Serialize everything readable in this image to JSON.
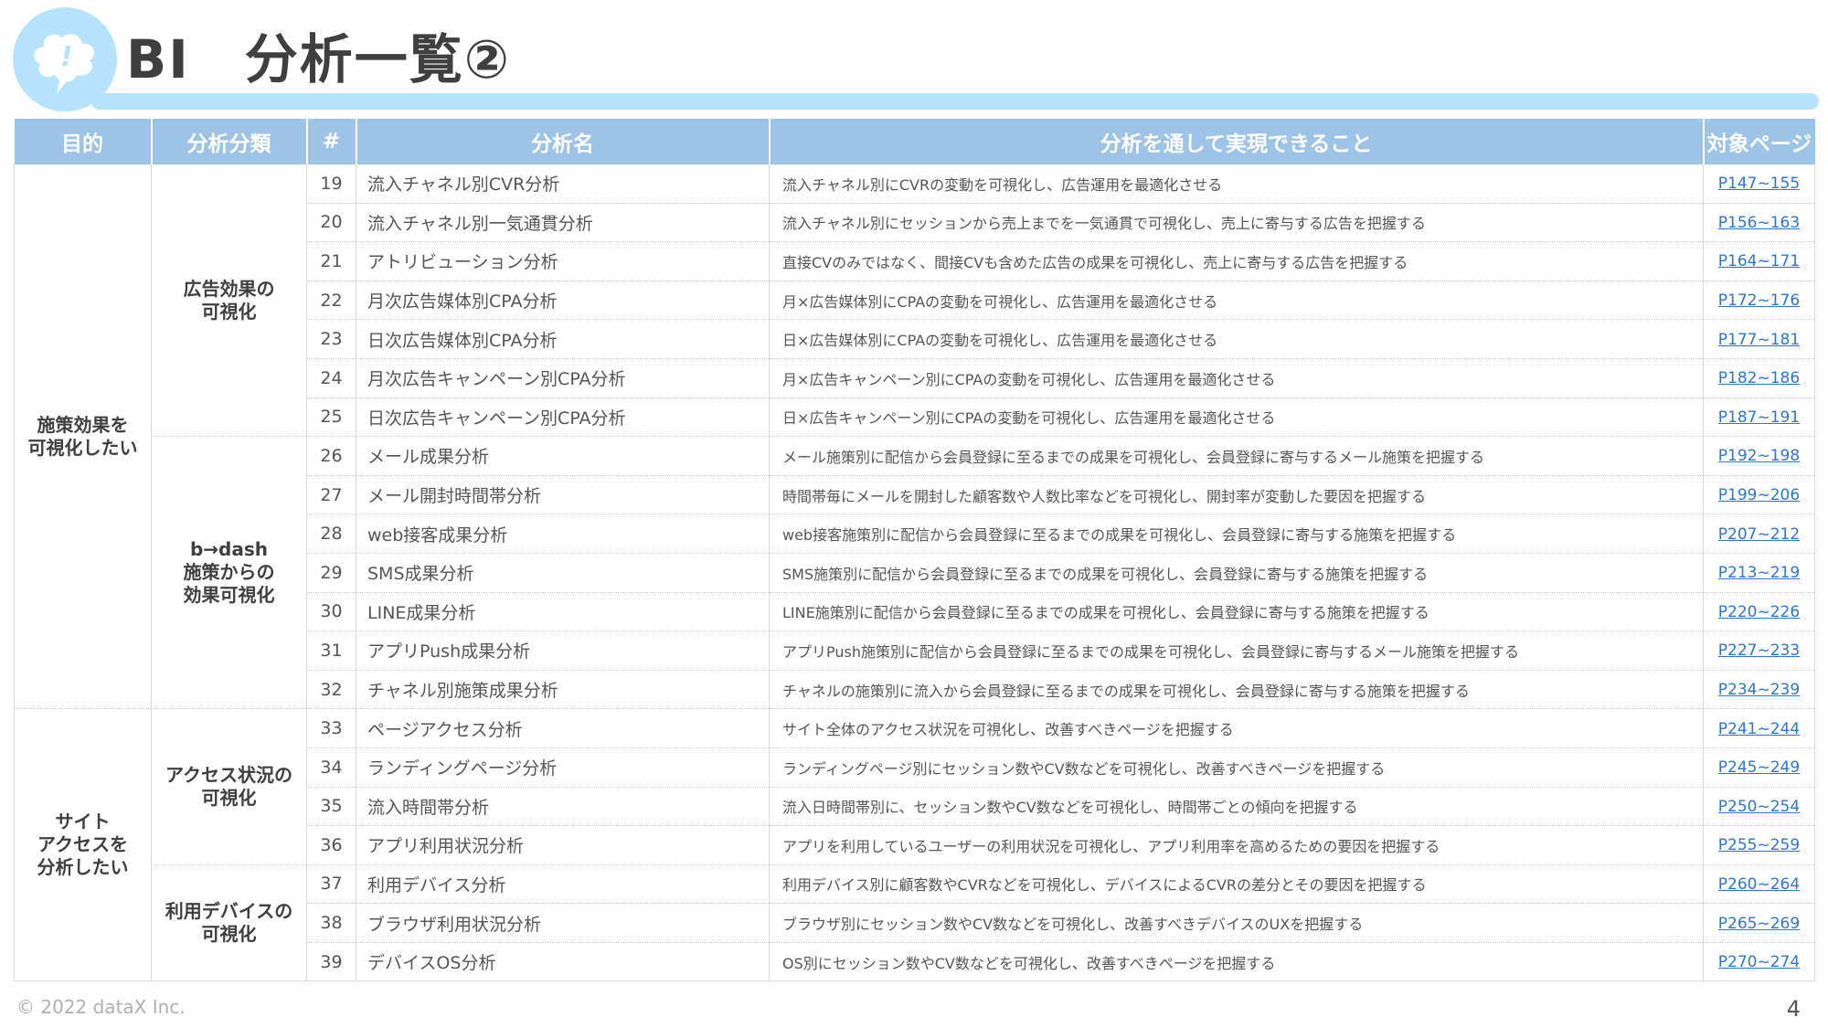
{
  "header": {
    "title": "BI　分析一覧②"
  },
  "table": {
    "columns": [
      "目的",
      "分析分類",
      "#",
      "分析名",
      "分析を通して実現できること",
      "対象ページ"
    ],
    "purposes": [
      {
        "label": "施策効果を\n可視化したい"
      },
      {
        "label": "サイト\nアクセスを\n分析したい"
      }
    ],
    "categories": [
      {
        "label": "広告効果の\n可視化"
      },
      {
        "label": "b→dash\n施策からの\n効果可視化"
      },
      {
        "label": "アクセス状況の\n可視化"
      },
      {
        "label": "利用デバイスの\n可視化"
      }
    ],
    "rows": [
      {
        "num": "19",
        "name": "流入チャネル別CVR分析",
        "desc": "流入チャネル別にCVRの変動を可視化し、広告運用を最適化させる",
        "page": "P147~155"
      },
      {
        "num": "20",
        "name": "流入チャネル別一気通貫分析",
        "desc": "流入チャネル別にセッションから売上までを一気通貫で可視化し、売上に寄与する広告を把握する",
        "page": "P156~163"
      },
      {
        "num": "21",
        "name": "アトリビューション分析",
        "desc": "直接CVのみではなく、間接CVも含めた広告の成果を可視化し、売上に寄与する広告を把握する",
        "page": "P164~171"
      },
      {
        "num": "22",
        "name": "月次広告媒体別CPA分析",
        "desc": "月×広告媒体別にCPAの変動を可視化し、広告運用を最適化させる",
        "page": "P172~176"
      },
      {
        "num": "23",
        "name": "日次広告媒体別CPA分析",
        "desc": "日×広告媒体別にCPAの変動を可視化し、広告運用を最適化させる",
        "page": "P177~181"
      },
      {
        "num": "24",
        "name": "月次広告キャンペーン別CPA分析",
        "desc": "月×広告キャンペーン別にCPAの変動を可視化し、広告運用を最適化させる",
        "page": "P182~186"
      },
      {
        "num": "25",
        "name": "日次広告キャンペーン別CPA分析",
        "desc": "日×広告キャンペーン別にCPAの変動を可視化し、広告運用を最適化させる",
        "page": "P187~191"
      },
      {
        "num": "26",
        "name": "メール成果分析",
        "desc": "メール施策別に配信から会員登録に至るまでの成果を可視化し、会員登録に寄与するメール施策を把握する",
        "page": "P192~198"
      },
      {
        "num": "27",
        "name": "メール開封時間帯分析",
        "desc": "時間帯毎にメールを開封した顧客数や人数比率などを可視化し、開封率が変動した要因を把握する",
        "page": "P199~206"
      },
      {
        "num": "28",
        "name": "web接客成果分析",
        "desc": "web接客施策別に配信から会員登録に至るまでの成果を可視化し、会員登録に寄与する施策を把握する",
        "page": "P207~212"
      },
      {
        "num": "29",
        "name": "SMS成果分析",
        "desc": "SMS施策別に配信から会員登録に至るまでの成果を可視化し、会員登録に寄与する施策を把握する",
        "page": "P213~219"
      },
      {
        "num": "30",
        "name": "LINE成果分析",
        "desc": "LINE施策別に配信から会員登録に至るまでの成果を可視化し、会員登録に寄与する施策を把握する",
        "page": "P220~226"
      },
      {
        "num": "31",
        "name": "アプリPush成果分析",
        "desc": "アプリPush施策別に配信から会員登録に至るまでの成果を可視化し、会員登録に寄与するメール施策を把握する",
        "page": "P227~233"
      },
      {
        "num": "32",
        "name": "チャネル別施策成果分析",
        "desc": "チャネルの施策別に流入から会員登録に至るまでの成果を可視化し、会員登録に寄与する施策を把握する",
        "page": "P234~239"
      },
      {
        "num": "33",
        "name": "ページアクセス分析",
        "desc": "サイト全体のアクセス状況を可視化し、改善すべきページを把握する",
        "page": "P241~244"
      },
      {
        "num": "34",
        "name": "ランディングページ分析",
        "desc": "ランディングページ別にセッション数やCV数などを可視化し、改善すべきページを把握する",
        "page": "P245~249"
      },
      {
        "num": "35",
        "name": "流入時間帯分析",
        "desc": "流入日時間帯別に、セッション数やCV数などを可視化し、時間帯ごとの傾向を把握する",
        "page": "P250~254"
      },
      {
        "num": "36",
        "name": "アプリ利用状況分析",
        "desc": "アプリを利用しているユーザーの利用状況を可視化し、アプリ利用率を高めるための要因を把握する",
        "page": "P255~259"
      },
      {
        "num": "37",
        "name": "利用デバイス分析",
        "desc": "利用デバイス別に顧客数やCVRなどを可視化し、デバイスによるCVRの差分とその要因を把握する",
        "page": "P260~264"
      },
      {
        "num": "38",
        "name": "ブラウザ利用状況分析",
        "desc": "ブラウザ別にセッション数やCV数などを可視化し、改善すべきデバイスのUXを把握する",
        "page": "P265~269"
      },
      {
        "num": "39",
        "name": "デバイスOS分析",
        "desc": "OS別にセッション数やCV数などを可視化し、改善すべきページを把握する",
        "page": "P270~274"
      }
    ]
  },
  "footer": {
    "copyright": "© 2022 dataX Inc.",
    "page_number": "4"
  }
}
